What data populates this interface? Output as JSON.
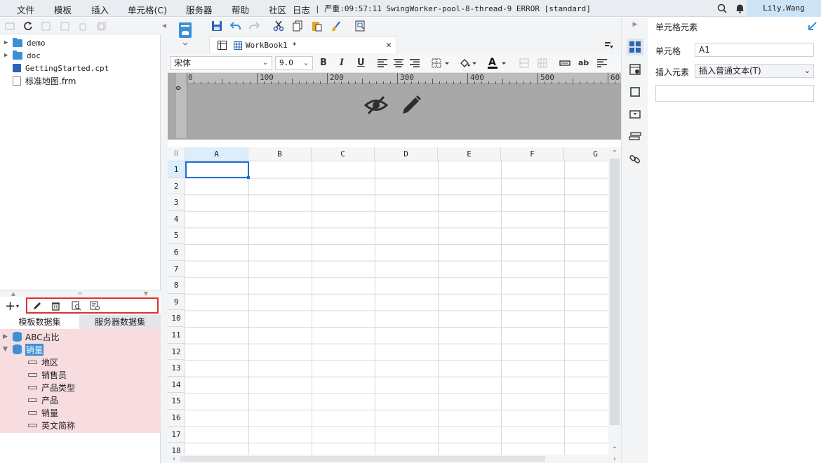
{
  "menu": {
    "items": [
      "文件",
      "模板",
      "插入",
      "单元格(C)",
      "服务器",
      "帮助",
      "社区",
      "日志"
    ],
    "log_text": "| 严重:09:57:11 SwingWorker-pool-8-thread-9 ERROR [standard]",
    "user": "Lily.Wang"
  },
  "file_tree": [
    {
      "name": "demo",
      "type": "folder"
    },
    {
      "name": "doc",
      "type": "folder"
    },
    {
      "name": "GettingStarted.cpt",
      "type": "cpt-file"
    },
    {
      "name": "标准地图.frm",
      "type": "frm-file"
    }
  ],
  "dataset_tabs": [
    "模板数据集",
    "服务器数据集"
  ],
  "datasets": [
    {
      "name": "ABC占比",
      "expanded": false
    },
    {
      "name": "销量",
      "expanded": true,
      "selected": true,
      "fields": [
        "地区",
        "销售员",
        "产品类型",
        "产品",
        "销量",
        "英文简称"
      ]
    }
  ],
  "workbook_tab": "WorkBook1 *",
  "format": {
    "font": "宋体",
    "size": "9.0",
    "bold": "B",
    "italic": "I",
    "underline": "U",
    "text_color": "#111111",
    "abc": "ab"
  },
  "ruler_labels": [
    "0",
    "100",
    "200",
    "300",
    "400",
    "500",
    "60"
  ],
  "vruler_label": "0",
  "columns": [
    "A",
    "B",
    "C",
    "D",
    "E",
    "F",
    "G"
  ],
  "rows": [
    "1",
    "2",
    "3",
    "4",
    "5",
    "6",
    "7",
    "8",
    "9",
    "10",
    "11",
    "12",
    "13",
    "14",
    "15",
    "16",
    "17",
    "18"
  ],
  "selected_cell": "A1",
  "right_panel": {
    "title": "单元格元素",
    "cell_label": "单元格",
    "cell_value": "A1",
    "insert_label": "插入元素",
    "insert_value": "插入普通文本(T)"
  },
  "colors": {
    "accent": "#3d8fd6",
    "selection": "#1f6fd6",
    "dataset_bg": "#f7dde0",
    "highlight_border": "#e03030"
  }
}
